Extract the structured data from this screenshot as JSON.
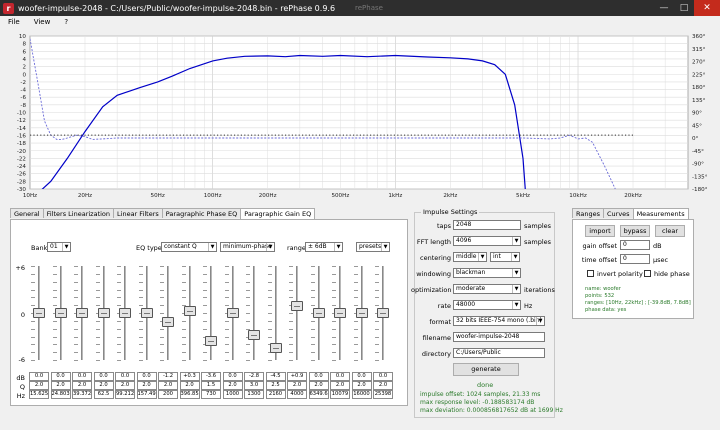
{
  "window": {
    "title": "woofer-impulse-2048  -  C:/Users/Public/woofer-impulse-2048.bin  -  rePhase 0.9.6",
    "faded": "rePhase"
  },
  "menu": [
    "File",
    "View",
    "?"
  ],
  "chart_data": {
    "type": "line",
    "x_scale": "log",
    "xlim": [
      10,
      40000
    ],
    "ylim": [
      -30,
      10
    ],
    "y2lim": [
      -180,
      360
    ],
    "grid": true,
    "x_ticks": [
      "10Hz",
      "20Hz",
      "50Hz",
      "100Hz",
      "200Hz",
      "500Hz",
      "1kHz",
      "2kHz",
      "5kHz",
      "10kHz",
      "20kHz"
    ],
    "x_tick_values": [
      10,
      20,
      50,
      100,
      200,
      500,
      1000,
      2000,
      5000,
      10000,
      20000
    ],
    "y_ticks": [
      "10",
      "8",
      "6",
      "4",
      "2",
      "0",
      "-2",
      "-4",
      "-6",
      "-8",
      "-10",
      "-12",
      "-14",
      "-16",
      "-18",
      "-20",
      "-22",
      "-24",
      "-26",
      "-28",
      "-30"
    ],
    "y2_ticks": [
      "360°",
      "315°",
      "270°",
      "225°",
      "180°",
      "135°",
      "90°",
      "45°",
      "0°",
      "-45°",
      "-90°",
      "-135°",
      "-180°"
    ],
    "series": [
      {
        "kind": "magnitude",
        "color": "#0000c8",
        "style": "solid",
        "x": [
          10,
          13,
          16,
          20,
          25,
          30,
          40,
          50,
          60,
          75,
          100,
          120,
          150,
          200,
          250,
          300,
          400,
          500,
          700,
          1000,
          1500,
          2000,
          2500,
          3000,
          3500,
          4000,
          4500,
          5000,
          5200
        ],
        "y": [
          -33,
          -28,
          -22,
          -15,
          -8.5,
          -5.5,
          -3.5,
          -2,
          -0.5,
          1.5,
          3.5,
          4.2,
          4.7,
          4.8,
          4.6,
          4.9,
          4.7,
          4.9,
          4.6,
          4.9,
          4.5,
          4.3,
          4.0,
          3.5,
          2.5,
          0,
          -8,
          -22,
          -33
        ]
      },
      {
        "kind": "phase",
        "color": "#6a6ad8",
        "style": "dashed",
        "x": [
          10,
          11,
          12,
          13,
          14,
          15,
          16,
          18,
          20,
          22,
          25,
          30,
          40,
          60,
          100,
          200,
          500,
          1000,
          2000,
          5000,
          7000,
          8000,
          9000,
          10000,
          11000,
          12000,
          14000,
          16000
        ],
        "y": [
          350,
          200,
          60,
          10,
          -5,
          -5,
          0,
          10,
          5,
          -5,
          -3,
          0,
          0,
          0,
          0,
          0,
          0,
          0,
          0,
          0,
          -3,
          0,
          10,
          -3,
          0,
          -15,
          -100,
          -180
        ]
      },
      {
        "kind": "reference",
        "color": "#303030",
        "style": "dotted",
        "x": [
          10,
          20000
        ],
        "y": [
          -15.9,
          -15.9
        ]
      }
    ]
  },
  "left_tabs": [
    "General",
    "Filters Linearization",
    "Linear Filters",
    "Paragraphic Phase EQ",
    "Paragraphic Gain EQ"
  ],
  "left_active_tab": 4,
  "eq": {
    "bank_label": "Bank",
    "bank_value": "01",
    "eq_type_label": "EQ type",
    "eq_type_value": "constant Q",
    "phase_value": "minimum-phase",
    "range_label": "range",
    "range_value": "± 6dB",
    "presets_label": "presets",
    "scale_top": "+6",
    "scale_mid": "0",
    "scale_bot": "-6",
    "row_labels": {
      "db": "dB",
      "q": "Q",
      "hz": "Hz"
    },
    "bands": [
      {
        "db": "0.0",
        "q": "2.0",
        "hz": "15.625",
        "level": 0.0
      },
      {
        "db": "0.0",
        "q": "2.0",
        "hz": "24.803",
        "level": 0.0
      },
      {
        "db": "0.0",
        "q": "2.0",
        "hz": "39.372",
        "level": 0.0
      },
      {
        "db": "0.0",
        "q": "2.0",
        "hz": "62.5",
        "level": 0.0
      },
      {
        "db": "0.0",
        "q": "2.0",
        "hz": "99.212",
        "level": 0.0
      },
      {
        "db": "0.0",
        "q": "2.0",
        "hz": "157.49",
        "level": 0.0
      },
      {
        "db": "-1.2",
        "q": "2.0",
        "hz": "200",
        "level": -1.2
      },
      {
        "db": "+0.3",
        "q": "2.0",
        "hz": "396.85",
        "level": 0.3
      },
      {
        "db": "-3.6",
        "q": "1.5",
        "hz": "730",
        "level": -3.6
      },
      {
        "db": "0.0",
        "q": "2.0",
        "hz": "1000",
        "level": 0.0
      },
      {
        "db": "-2.8",
        "q": "3.0",
        "hz": "1300",
        "level": -2.8
      },
      {
        "db": "-4.5",
        "q": "2.5",
        "hz": "2160",
        "level": -4.5
      },
      {
        "db": "+0.9",
        "q": "2.0",
        "hz": "4000",
        "level": 0.9
      },
      {
        "db": "0.0",
        "q": "2.0",
        "hz": "6349.6",
        "level": 0.0
      },
      {
        "db": "0.0",
        "q": "2.0",
        "hz": "10079",
        "level": 0.0
      },
      {
        "db": "0.0",
        "q": "2.0",
        "hz": "16000",
        "level": 0.0
      },
      {
        "db": "0.0",
        "q": "2.0",
        "hz": "25398",
        "level": 0.0
      }
    ]
  },
  "impulse": {
    "group_title": "Impulse Settings",
    "taps_label": "taps",
    "taps_value": "2048",
    "taps_unit": "samples",
    "fft_label": "FFT length",
    "fft_value": "4096",
    "fft_unit": "samples",
    "centering_label": "centering",
    "centering_value": "middle",
    "centering_type": "int",
    "windowing_label": "windowing",
    "windowing_value": "blackman",
    "optimization_label": "optimization",
    "optimization_value": "moderate",
    "optimization_unit": "iterations",
    "rate_label": "rate",
    "rate_value": "48000",
    "rate_unit": "Hz",
    "format_label": "format",
    "format_value": "32 bits IEEE-754 mono (.bin)",
    "filename_label": "filename",
    "filename_value": "woofer-impulse-2048",
    "directory_label": "directory",
    "directory_value": "C:/Users/Public",
    "generate_label": "generate",
    "status": "done",
    "info": [
      "impulse offset: 1024 samples, 21.33 ms",
      "max response level: -0.188583174 dB",
      "max deviation: 0.000856817652 dB at 1699 Hz"
    ]
  },
  "right_tabs": [
    "Ranges",
    "Curves",
    "Measurements"
  ],
  "right_active_tab": 2,
  "measurements": {
    "import_label": "import",
    "bypass_label": "bypass",
    "clear_label": "clear",
    "gain_offset_label": "gain offset",
    "gain_offset_value": "0",
    "gain_offset_unit": "dB",
    "time_offset_label": "time offset",
    "time_offset_value": "0",
    "time_offset_unit": "µsec",
    "invert_polarity_label": "invert polarity",
    "hide_phase_label": "hide phase",
    "info": [
      "name: woofer",
      "points: 532",
      "ranges: [10Hz, 22kHz] ; [-39.8dB, 7.8dB]",
      "phase data: yes"
    ]
  }
}
